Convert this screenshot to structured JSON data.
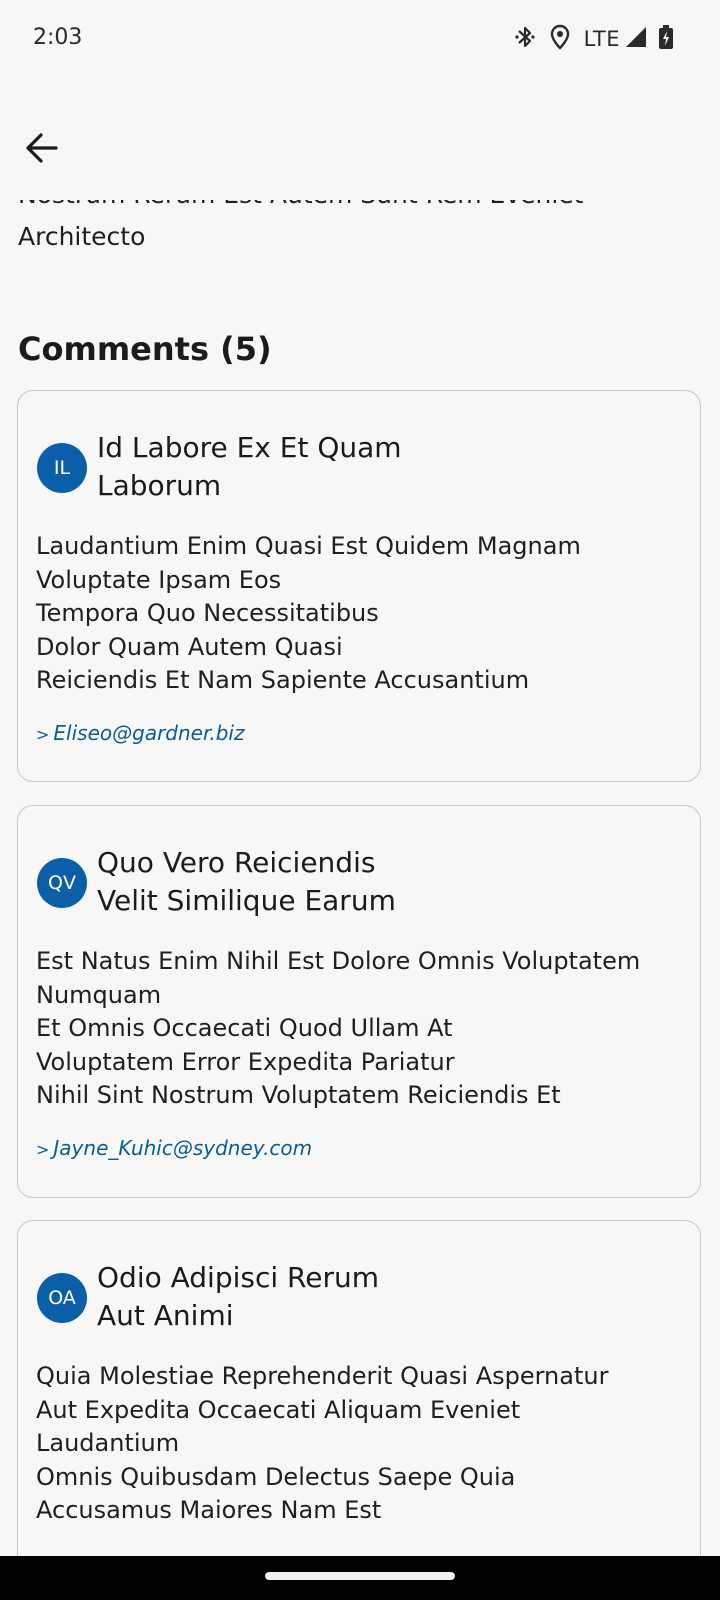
{
  "status_bar": {
    "time": "2:03",
    "network": "LTE",
    "icons": [
      "bluetooth-icon",
      "location-icon",
      "signal-icon",
      "battery-icon"
    ]
  },
  "header": {
    "back_icon": "arrow-left-icon"
  },
  "post": {
    "body_tail_line1": "Nostrum Rerum Est Autem Sunt Rem Eveniet",
    "body_tail_line2": "Architecto"
  },
  "comments": {
    "title": "Comments (5)",
    "items": [
      {
        "initials": "IL",
        "title_line1": "Id Labore Ex Et Quam",
        "title_line2": "Laborum",
        "body": "Laudantium Enim Quasi Est Quidem Magnam\nVoluptate Ipsam Eos\nTempora Quo Necessitatibus\nDolor Quam Autem Quasi\nReiciendis Et Nam Sapiente Accusantium",
        "email": "Eliseo@gardner.biz"
      },
      {
        "initials": "QV",
        "title_line1": "Quo Vero Reiciendis",
        "title_line2": "Velit Similique Earum",
        "body": "Est Natus Enim Nihil Est Dolore Omnis Voluptatem\nNumquam\nEt Omnis Occaecati Quod Ullam At\nVoluptatem Error Expedita Pariatur\nNihil Sint Nostrum Voluptatem Reiciendis Et",
        "email": "Jayne_Kuhic@sydney.com"
      },
      {
        "initials": "OA",
        "title_line1": "Odio Adipisci Rerum",
        "title_line2": "Aut Animi",
        "body": "Quia Molestiae Reprehenderit Quasi Aspernatur\nAut Expedita Occaecati Aliquam Eveniet\nLaudantium\nOmnis Quibusdam Delectus Saepe Quia\nAccusamus Maiores Nam Est",
        "email": ""
      }
    ]
  },
  "colors": {
    "background": "#f7f7f7",
    "avatar": "#0a5fa8",
    "email_link": "#0e5a93",
    "card_border": "#c8c8c8"
  }
}
